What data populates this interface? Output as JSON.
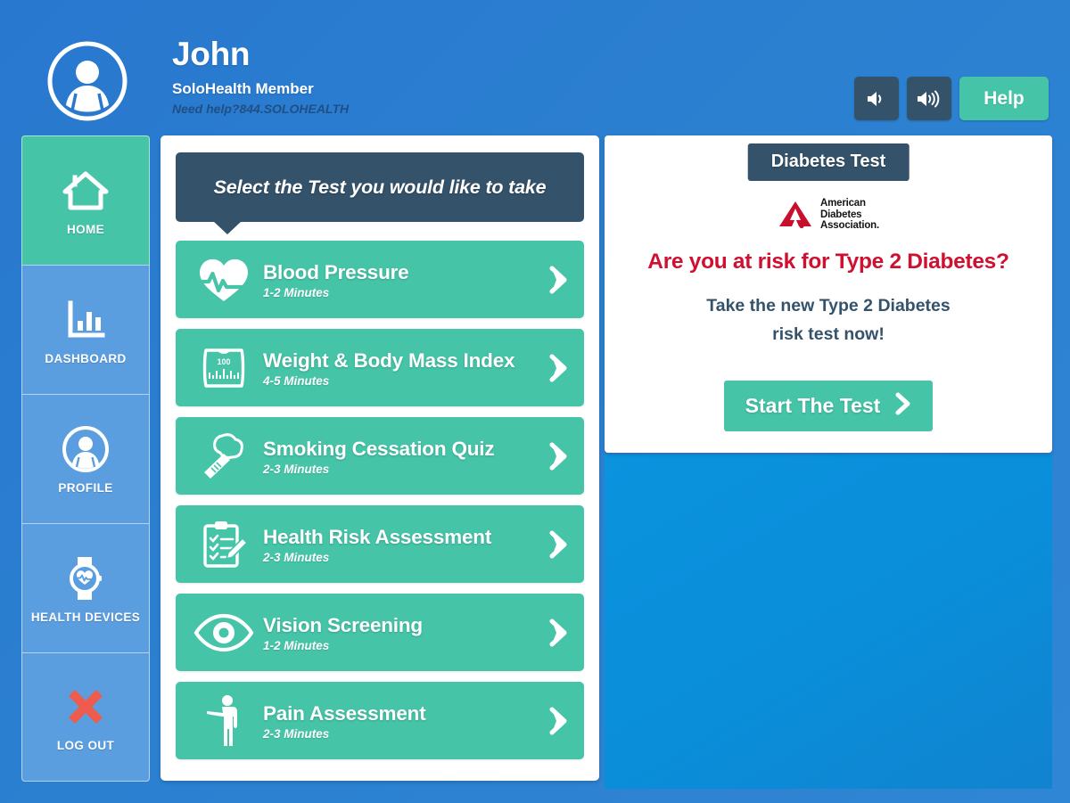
{
  "header": {
    "avatar_icon": "user-avatar-icon",
    "user_name": "John",
    "user_role": "SoloHealth Member",
    "help_phone": "Need help?844.SOLOHEALTH",
    "volume_down_icon": "speaker-low-icon",
    "volume_up_icon": "speaker-high-icon",
    "help_label": "Help"
  },
  "sidebar": {
    "items": [
      {
        "label": "HOME",
        "icon": "house-icon",
        "active": true
      },
      {
        "label": "DASHBOARD",
        "icon": "bar-chart-icon",
        "active": false
      },
      {
        "label": "PROFILE",
        "icon": "person-circle-icon",
        "active": false
      },
      {
        "label": "HEALTH DEVICES",
        "icon": "smartwatch-heart-icon",
        "active": false
      },
      {
        "label": "LOG OUT",
        "icon": "red-x-icon",
        "active": false
      }
    ]
  },
  "tests_panel": {
    "prompt": "Select the Test you would like to take",
    "chevron_icon": "chevron-right-icon",
    "items": [
      {
        "title": "Blood Pressure",
        "duration": "1-2 Minutes",
        "icon": "heart-pulse-icon"
      },
      {
        "title": "Weight & Body Mass Index",
        "duration": "4-5 Minutes",
        "icon": "scale-icon"
      },
      {
        "title": "Smoking Cessation Quiz",
        "duration": "2-3 Minutes",
        "icon": "cigarette-smoke-icon"
      },
      {
        "title": "Health Risk Assessment",
        "duration": "2-3 Minutes",
        "icon": "clipboard-pencil-icon"
      },
      {
        "title": "Vision Screening",
        "duration": "1-2 Minutes",
        "icon": "eye-icon"
      },
      {
        "title": "Pain Assessment",
        "duration": "2-3 Minutes",
        "icon": "human-body-icon"
      }
    ]
  },
  "promo": {
    "tab_label": "Diabetes Test",
    "logo_icon": "american-diabetes-association-logo",
    "logo_line1": "American",
    "logo_line2": "Diabetes",
    "logo_line3": "Association.",
    "headline": "Are you at risk for Type 2 Diabetes?",
    "subtext_line1": "Take the new Type 2 Diabetes",
    "subtext_line2": "risk test now!",
    "button_label": "Start The Test",
    "button_icon": "chevron-right-icon"
  },
  "colors": {
    "background_blue": "#2878cf",
    "accent_green": "#45c4a8",
    "navy": "#34536b",
    "sidebar_blue": "#5b9ee0",
    "promo_panel_blue": "#0b93de",
    "headline_red": "#cf1030",
    "logout_red": "#ef5b4c"
  }
}
